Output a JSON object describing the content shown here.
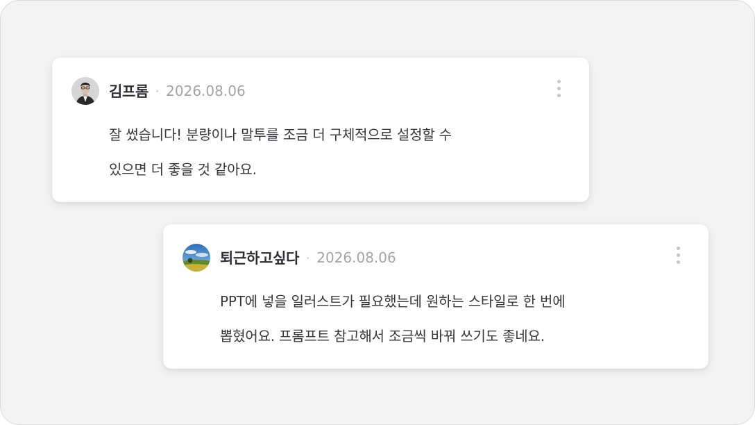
{
  "comments": [
    {
      "author": "김프롬",
      "separator": "·",
      "date": "2026.08.06",
      "text_lines": [
        "잘 썼습니다! 분량이나 말투를 조금 더 구체적으로 설정할 수",
        "있으면 더 좋을 것 같아요."
      ],
      "avatar_icon": "person-photo-icon",
      "more_icon": "more-vertical-icon"
    },
    {
      "author": "퇴근하고싶다",
      "separator": "·",
      "date": "2026.08.06",
      "text_lines": [
        "PPT에 넣을 일러스트가 필요했는데 원하는 스타일로 한 번에",
        "뽑혔어요. 프롬프트 참고해서 조금씩 바꿔 쓰기도 좋네요."
      ],
      "avatar_icon": "landscape-photo-icon",
      "more_icon": "more-vertical-icon"
    }
  ],
  "colors": {
    "background": "#f3f3f4",
    "card": "#ffffff",
    "author": "#2f2f33",
    "date": "#a3a3a8",
    "body": "#38383c"
  }
}
